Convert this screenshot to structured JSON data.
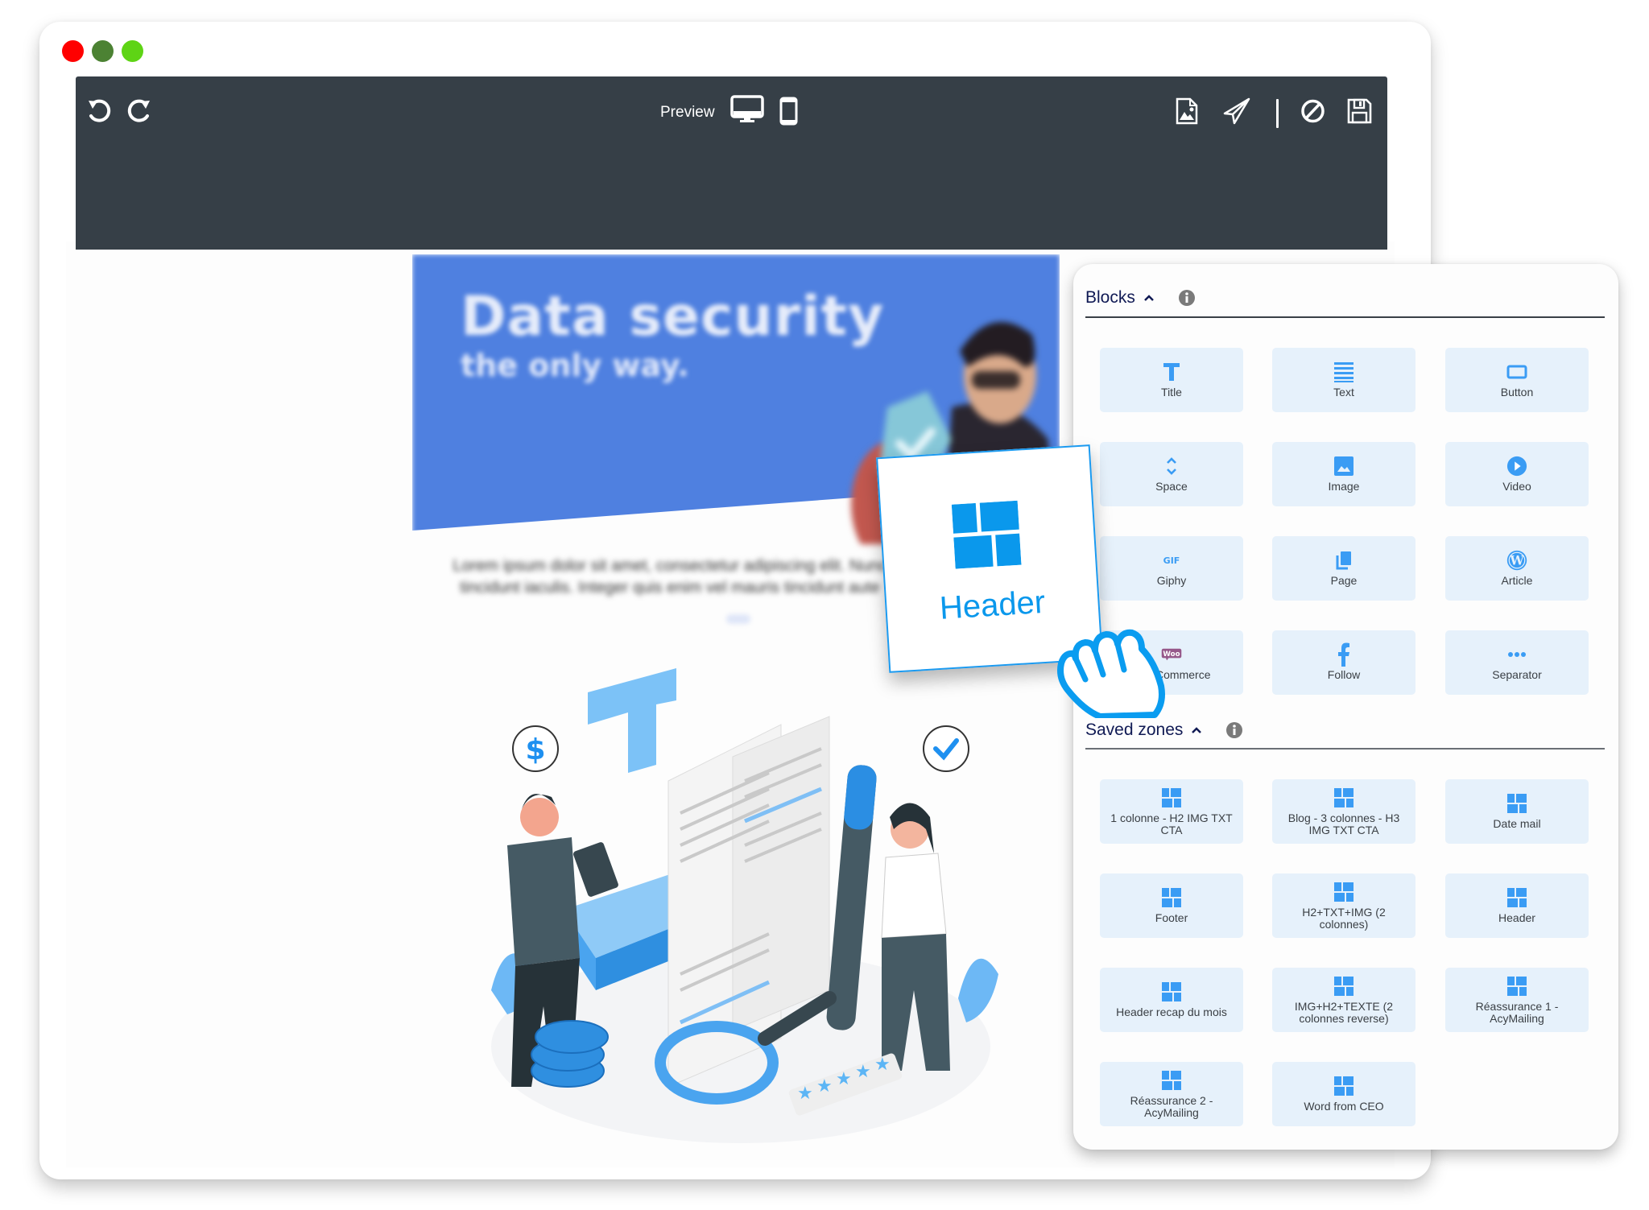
{
  "window": {
    "traffic_lights": [
      "close",
      "minimize",
      "maximize"
    ]
  },
  "toolbar": {
    "undo_icon": "undo-icon",
    "redo_icon": "redo-icon",
    "preview_label": "Preview",
    "desktop_icon": "desktop-icon",
    "mobile_icon": "mobile-icon",
    "right_icons": [
      "image-file-icon",
      "send-icon",
      "cancel-icon",
      "save-icon"
    ]
  },
  "preview": {
    "hero_title": "Data security",
    "hero_subtitle": "the only way.",
    "paragraph_line1": "Lorem ipsum dolor sit amet, consectetur adipiscing elit. Nunc",
    "paragraph_line2": "tincidunt iaculis. Integer quis enim vel mauris tincidunt aute"
  },
  "drag_card": {
    "label": "Header",
    "icon": "grid-icon"
  },
  "panel": {
    "blocks": {
      "title": "Blocks",
      "items": [
        {
          "label": "Title",
          "icon": "title-icon"
        },
        {
          "label": "Text",
          "icon": "text-icon"
        },
        {
          "label": "Button",
          "icon": "button-icon"
        },
        {
          "label": "Space",
          "icon": "space-icon"
        },
        {
          "label": "Image",
          "icon": "image-icon"
        },
        {
          "label": "Video",
          "icon": "video-icon"
        },
        {
          "label": "Giphy",
          "icon": "gif-icon"
        },
        {
          "label": "Page",
          "icon": "page-icon"
        },
        {
          "label": "Article",
          "icon": "wordpress-icon"
        },
        {
          "label": "WooCommerce",
          "icon": "woo-icon"
        },
        {
          "label": "Follow",
          "icon": "facebook-icon"
        },
        {
          "label": "Separator",
          "icon": "separator-icon"
        }
      ]
    },
    "saved_zones": {
      "title": "Saved zones",
      "items": [
        {
          "label": "1 colonne - H2 IMG TXT CTA"
        },
        {
          "label": "Blog - 3 colonnes - H3 IMG TXT CTA"
        },
        {
          "label": "Date mail"
        },
        {
          "label": "Footer"
        },
        {
          "label": "H2+TXT+IMG (2 colonnes)"
        },
        {
          "label": "Header"
        },
        {
          "label": "Header recap du mois"
        },
        {
          "label": "IMG+H2+TEXTE (2 colonnes reverse)"
        },
        {
          "label": "Réassurance 1 - AcyMailing"
        },
        {
          "label": "Réassurance 2 - AcyMailing"
        },
        {
          "label": "Word from CEO"
        }
      ]
    }
  },
  "colors": {
    "toolbar_bg": "#363f47",
    "accent": "#0a98ec",
    "tile_bg": "#e6f1fb",
    "tile_icon": "#3a9cf4",
    "section_title": "#101a54",
    "hero_blue": "#4f80e0"
  }
}
